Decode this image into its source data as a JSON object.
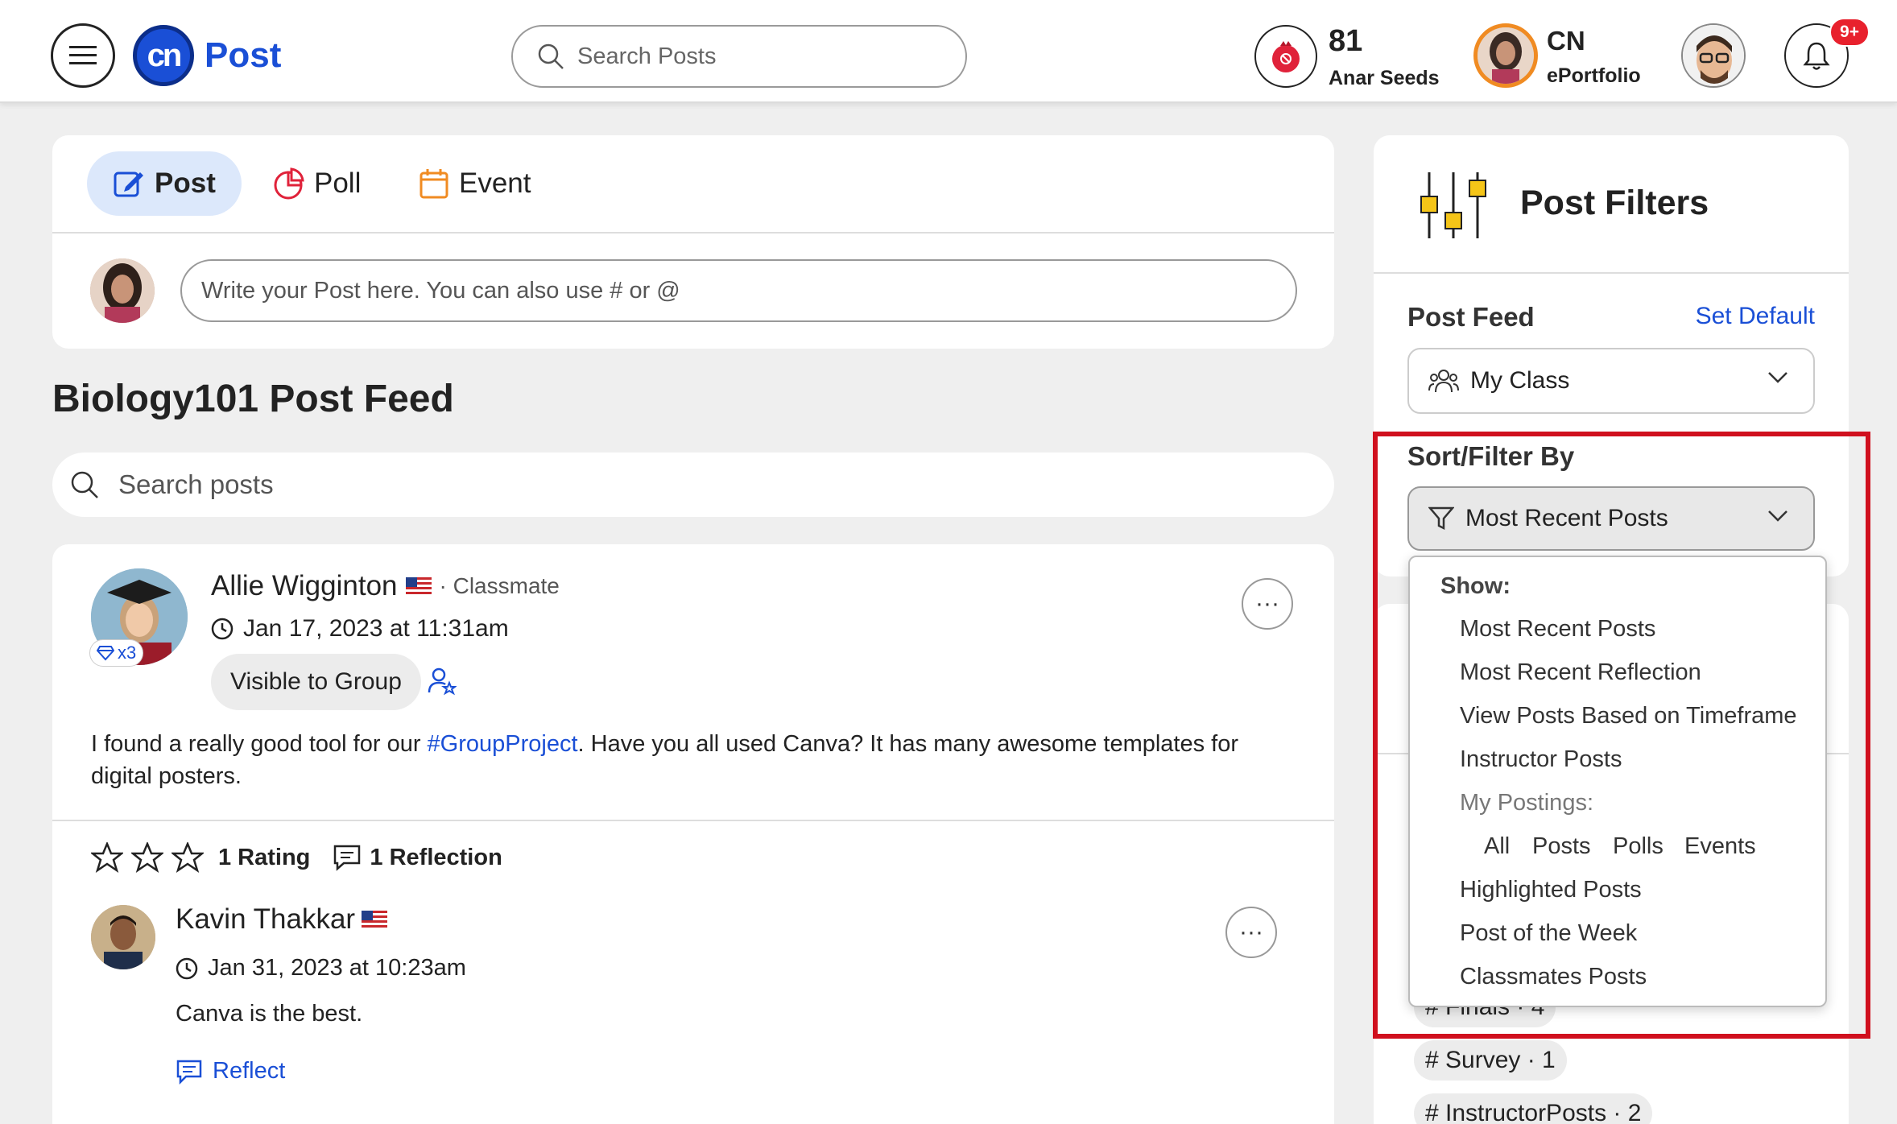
{
  "header": {
    "logo_text": "Post",
    "logo_badge": "cn",
    "search_placeholder": "Search Posts",
    "seeds": {
      "count": "81",
      "label": "Anar Seeds"
    },
    "portfolio": {
      "title": "CN",
      "subtitle": "ePortfolio"
    },
    "notifications": {
      "badge": "9+"
    }
  },
  "composer": {
    "tabs": [
      {
        "label": "Post",
        "icon": "edit-icon",
        "active": true
      },
      {
        "label": "Poll",
        "icon": "pie-chart-icon"
      },
      {
        "label": "Event",
        "icon": "calendar-icon"
      }
    ],
    "placeholder": "Write your Post here. You can also use # or @"
  },
  "feed": {
    "title": "Biology101 Post Feed",
    "search_placeholder": "Search posts"
  },
  "post": {
    "author": "Allie Wigginton",
    "role": "· Classmate",
    "badge_count": "x3",
    "timestamp": "Jan 17, 2023 at 11:31am",
    "visibility": "Visible to Group",
    "body_before": "I found a really good tool for our ",
    "body_tag": "#GroupProject",
    "body_after": ". Have you all used Canva? It has many awesome templates for digital posters.",
    "rating_label": "1 Rating",
    "reflection_label": "1 Reflection",
    "more_label": "···",
    "reply": {
      "author": "Kavin Thakkar",
      "timestamp": "Jan 31, 2023 at 10:23am",
      "text": "Canva is the best.",
      "reflect_label": "Reflect",
      "more_label": "···"
    }
  },
  "filters": {
    "title": "Post Filters",
    "post_feed_label": "Post Feed",
    "set_default": "Set Default",
    "feed_selected": "My Class",
    "sort_label": "Sort/Filter By",
    "sort_selected": "Most Recent Posts",
    "dropdown": {
      "show_label": "Show:",
      "items_top": [
        "Most Recent Posts",
        "Most Recent Reflection",
        "View Posts Based on Timeframe",
        "Instructor Posts"
      ],
      "my_postings_label": "My Postings:",
      "my_postings": [
        "All",
        "Posts",
        "Polls",
        "Events"
      ],
      "items_bottom": [
        "Highlighted Posts",
        "Post of the Week",
        "Classmates Posts"
      ]
    },
    "hashtags": [
      "# Finals · 4",
      "# Survey · 1",
      "# InstructorPosts · 2"
    ]
  },
  "colors": {
    "accent": "#1a4fd6",
    "highlight": "#d0101e",
    "badge": "#e8212d"
  }
}
